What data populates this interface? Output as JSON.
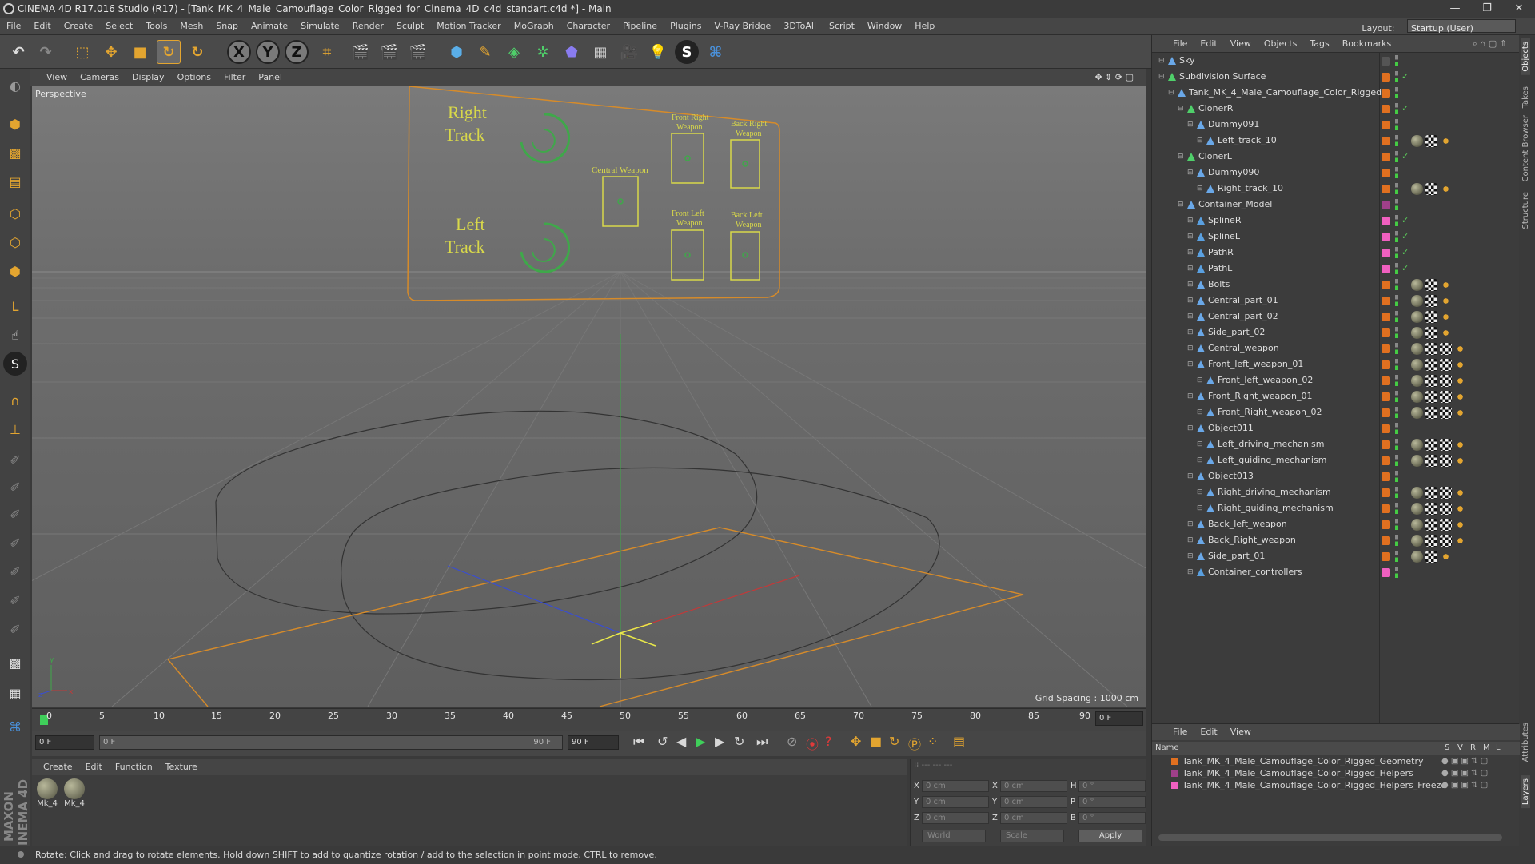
{
  "title": "CINEMA 4D R17.016 Studio (R17) - [Tank_MK_4_Male_Camouflage_Color_Rigged_for_Cinema_4D_c4d_standart.c4d *] - Main",
  "menu": [
    "File",
    "Edit",
    "Create",
    "Select",
    "Tools",
    "Mesh",
    "Snap",
    "Animate",
    "Simulate",
    "Render",
    "Sculpt",
    "Motion Tracker",
    "MoGraph",
    "Character",
    "Pipeline",
    "Plugins",
    "V-Ray Bridge",
    "3DToAll",
    "Script",
    "Window",
    "Help"
  ],
  "layout": {
    "label": "Layout:",
    "value": "Startup (User)"
  },
  "toolbar_axes": [
    "X",
    "Y",
    "Z"
  ],
  "viewport": {
    "menu": [
      "View",
      "Cameras",
      "Display",
      "Options",
      "Filter",
      "Panel"
    ],
    "label": "Perspective",
    "grid_spacing": "Grid Spacing : 1000 cm",
    "panel": {
      "right_track": [
        "Right",
        "Track"
      ],
      "left_track": [
        "Left",
        "Track"
      ],
      "central_weapon": "Central Weapon",
      "front_right_weapon": [
        "Front Right",
        "Weapon"
      ],
      "back_right_weapon": [
        "Back Right",
        "Weapon"
      ],
      "front_left_weapon": [
        "Front Left",
        "Weapon"
      ],
      "back_left_weapon": [
        "Back Left",
        "Weapon"
      ]
    },
    "axis_y": "y",
    "axis_z": "z",
    "axis_x": "x"
  },
  "timeline": {
    "ticks": [
      "0",
      "5",
      "10",
      "15",
      "20",
      "25",
      "30",
      "35",
      "40",
      "45",
      "50",
      "55",
      "60",
      "65",
      "70",
      "75",
      "80",
      "85",
      "90"
    ],
    "current_frame": "0 F"
  },
  "playbar": {
    "start": "0 F",
    "slider_start": "0 F",
    "slider_end": "90 F",
    "end": "90 F"
  },
  "material_manager": {
    "menu": [
      "Create",
      "Edit",
      "Function",
      "Texture"
    ],
    "materials": [
      "Mk_4",
      "Mk_4"
    ]
  },
  "coordinates": {
    "rows": [
      {
        "a": "X",
        "av": "0 cm",
        "b": "X",
        "bv": "0 cm",
        "c": "H",
        "cv": "0 °"
      },
      {
        "a": "Y",
        "av": "0 cm",
        "b": "Y",
        "bv": "0 cm",
        "c": "P",
        "cv": "0 °"
      },
      {
        "a": "Z",
        "av": "0 cm",
        "b": "Z",
        "bv": "0 cm",
        "c": "B",
        "cv": "0 °"
      }
    ],
    "mode": "World",
    "scale": "Scale",
    "apply": "Apply"
  },
  "status": "Rotate: Click and drag to rotate elements. Hold down SHIFT to add to quantize rotation / add to the selection in point mode, CTRL to remove.",
  "object_manager": {
    "menu": [
      "File",
      "Edit",
      "View",
      "Objects",
      "Tags",
      "Bookmarks"
    ],
    "objects": [
      {
        "name": "Sky",
        "indent": 0,
        "color": "#555555",
        "check": ""
      },
      {
        "name": "Subdivision Surface",
        "indent": 0,
        "color": "#e07020",
        "check": "✓"
      },
      {
        "name": "Tank_MK_4_Male_Camouflage_Color_Rigged",
        "indent": 1,
        "color": "#e07020",
        "check": ""
      },
      {
        "name": "ClonerR",
        "indent": 2,
        "color": "#e07020",
        "check": "✓"
      },
      {
        "name": "Dummy091",
        "indent": 3,
        "color": "#e07020",
        "check": ""
      },
      {
        "name": "Left_track_10",
        "indent": 4,
        "color": "#e07020",
        "check": ""
      },
      {
        "name": "ClonerL",
        "indent": 2,
        "color": "#e07020",
        "check": "✓"
      },
      {
        "name": "Dummy090",
        "indent": 3,
        "color": "#e07020",
        "check": ""
      },
      {
        "name": "Right_track_10",
        "indent": 4,
        "color": "#e07020",
        "check": ""
      },
      {
        "name": "Container_Model",
        "indent": 2,
        "color": "#a0408a",
        "check": ""
      },
      {
        "name": "SplineR",
        "indent": 3,
        "color": "#f060c0",
        "check": "✓"
      },
      {
        "name": "SplineL",
        "indent": 3,
        "color": "#f060c0",
        "check": "✓"
      },
      {
        "name": "PathR",
        "indent": 3,
        "color": "#f060c0",
        "check": "✓"
      },
      {
        "name": "PathL",
        "indent": 3,
        "color": "#f060c0",
        "check": "✓"
      },
      {
        "name": "Bolts",
        "indent": 3,
        "color": "#e07020",
        "check": ""
      },
      {
        "name": "Central_part_01",
        "indent": 3,
        "color": "#e07020",
        "check": ""
      },
      {
        "name": "Central_part_02",
        "indent": 3,
        "color": "#e07020",
        "check": ""
      },
      {
        "name": "Side_part_02",
        "indent": 3,
        "color": "#e07020",
        "check": ""
      },
      {
        "name": "Central_weapon",
        "indent": 3,
        "color": "#e07020",
        "check": ""
      },
      {
        "name": "Front_left_weapon_01",
        "indent": 3,
        "color": "#e07020",
        "check": ""
      },
      {
        "name": "Front_left_weapon_02",
        "indent": 4,
        "color": "#e07020",
        "check": ""
      },
      {
        "name": "Front_Right_weapon_01",
        "indent": 3,
        "color": "#e07020",
        "check": ""
      },
      {
        "name": "Front_Right_weapon_02",
        "indent": 4,
        "color": "#e07020",
        "check": ""
      },
      {
        "name": "Object011",
        "indent": 3,
        "color": "#e07020",
        "check": ""
      },
      {
        "name": "Left_driving_mechanism",
        "indent": 4,
        "color": "#e07020",
        "check": ""
      },
      {
        "name": "Left_guiding_mechanism",
        "indent": 4,
        "color": "#e07020",
        "check": ""
      },
      {
        "name": "Object013",
        "indent": 3,
        "color": "#e07020",
        "check": ""
      },
      {
        "name": "Right_driving_mechanism",
        "indent": 4,
        "color": "#e07020",
        "check": ""
      },
      {
        "name": "Right_guiding_mechanism",
        "indent": 4,
        "color": "#e07020",
        "check": ""
      },
      {
        "name": "Back_left_weapon",
        "indent": 3,
        "color": "#e07020",
        "check": ""
      },
      {
        "name": "Back_Right_weapon",
        "indent": 3,
        "color": "#e07020",
        "check": ""
      },
      {
        "name": "Side_part_01",
        "indent": 3,
        "color": "#e07020",
        "check": ""
      },
      {
        "name": "Container_controllers",
        "indent": 3,
        "color": "#f060c0",
        "check": ""
      }
    ]
  },
  "layer_manager": {
    "menu": [
      "File",
      "Edit",
      "View"
    ],
    "header": "Name",
    "cols": [
      "S",
      "V",
      "R",
      "M",
      "L"
    ],
    "layers": [
      {
        "name": "Tank_MK_4_Male_Camouflage_Color_Rigged_Geometry",
        "color": "#e07020"
      },
      {
        "name": "Tank_MK_4_Male_Camouflage_Color_Rigged_Helpers",
        "color": "#a0408a"
      },
      {
        "name": "Tank_MK_4_Male_Camouflage_Color_Rigged_Helpers_Freeze",
        "color": "#f060c0"
      }
    ]
  },
  "side_tabs": [
    "Objects",
    "Takes",
    "Content Browser",
    "Structure"
  ],
  "side_tabs_bottom": [
    "Attributes",
    "Layers"
  ]
}
